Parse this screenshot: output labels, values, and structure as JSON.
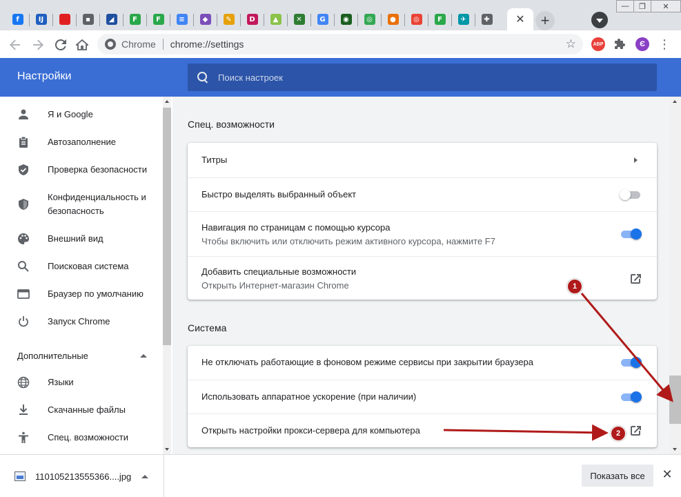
{
  "browser": {
    "tabs": [
      {
        "icon": "facebook-icon",
        "glyph": "f",
        "color": "#1877f2"
      },
      {
        "icon": "ij-icon",
        "glyph": "IJ",
        "color": "#1f5fbf"
      },
      {
        "icon": "red-flag-icon",
        "glyph": "",
        "color": "#e02020"
      },
      {
        "icon": "folder-icon",
        "glyph": "▪",
        "color": "#5f6368"
      },
      {
        "icon": "chart-icon",
        "glyph": "◢",
        "color": "#1f4f9f"
      },
      {
        "icon": "f-green-icon",
        "glyph": "F",
        "color": "#2aa84a"
      },
      {
        "icon": "f-green-icon",
        "glyph": "F",
        "color": "#2aa84a"
      },
      {
        "icon": "docs-icon",
        "glyph": "≡",
        "color": "#4285f4"
      },
      {
        "icon": "purple-diamond-icon",
        "glyph": "◆",
        "color": "#7b4fb8"
      },
      {
        "icon": "pencil-icon",
        "glyph": "✎",
        "color": "#e5a10b"
      },
      {
        "icon": "d-icon",
        "glyph": "D",
        "color": "#c2185b"
      },
      {
        "icon": "android-icon",
        "glyph": "▲",
        "color": "#8bc34a"
      },
      {
        "icon": "tools-icon",
        "glyph": "✕",
        "color": "#2e7d32"
      },
      {
        "icon": "google-icon",
        "glyph": "G",
        "color": "#4285f4"
      },
      {
        "icon": "eye-icon",
        "glyph": "◉",
        "color": "#1b5e20"
      },
      {
        "icon": "chrome-icon",
        "glyph": "◎",
        "color": "#34a853"
      },
      {
        "icon": "orange-circle-icon",
        "glyph": "●",
        "color": "#e8710a"
      },
      {
        "icon": "chrome-icon",
        "glyph": "◎",
        "color": "#ea4335"
      },
      {
        "icon": "f-green-icon",
        "glyph": "F",
        "color": "#2aa84a"
      },
      {
        "icon": "plane-icon",
        "glyph": "✈",
        "color": "#0097a7"
      },
      {
        "icon": "puzzle-icon",
        "glyph": "✚",
        "color": "#5f6368"
      }
    ],
    "active_tab_close": "✕",
    "new_tab_label": "+",
    "window_controls": [
      "—",
      "❐",
      "✕"
    ],
    "omnibox": {
      "site": "Chrome",
      "url": "chrome://settings"
    },
    "extensions": {
      "abp_label": "ABP",
      "profile_initial": "Є"
    }
  },
  "settings": {
    "header_title": "Настройки",
    "search_placeholder": "Поиск настроек",
    "sidebar": {
      "items": [
        {
          "label": "Я и Google",
          "icon": "person-icon"
        },
        {
          "label": "Автозаполнение",
          "icon": "clipboard-icon"
        },
        {
          "label": "Проверка безопасности",
          "icon": "shield-check-icon"
        },
        {
          "label": "Конфиденциальность и безопасность",
          "icon": "shield-icon"
        },
        {
          "label": "Внешний вид",
          "icon": "palette-icon"
        },
        {
          "label": "Поисковая система",
          "icon": "search-icon"
        },
        {
          "label": "Браузер по умолчанию",
          "icon": "browser-icon"
        },
        {
          "label": "Запуск Chrome",
          "icon": "power-icon"
        }
      ],
      "advanced_label": "Дополнительные",
      "advanced_items": [
        {
          "label": "Языки",
          "icon": "globe-icon"
        },
        {
          "label": "Скачанные файлы",
          "icon": "download-icon"
        },
        {
          "label": "Спец. возможности",
          "icon": "accessibility-icon"
        }
      ]
    },
    "accessibility": {
      "title": "Спец. возможности",
      "rows": [
        {
          "title": "Титры",
          "control": "chevron"
        },
        {
          "title": "Быстро выделять выбранный объект",
          "control": "toggle",
          "on": false
        },
        {
          "title": "Навигация по страницам с помощью курсора",
          "subtitle": "Чтобы включить или отключить режим активного курсора, нажмите F7",
          "control": "toggle",
          "on": true
        },
        {
          "title": "Добавить специальные возможности",
          "subtitle": "Открыть Интернет-магазин Chrome",
          "control": "external"
        }
      ]
    },
    "system": {
      "title": "Система",
      "rows": [
        {
          "title": "Не отключать работающие в фоновом режиме сервисы при закрытии браузера",
          "control": "toggle",
          "on": true
        },
        {
          "title": "Использовать аппаратное ускорение (при наличии)",
          "control": "toggle",
          "on": true
        },
        {
          "title": "Открыть настройки прокси-сервера для компьютера",
          "control": "external"
        }
      ]
    }
  },
  "downloads": {
    "file_name": "110105213555366....jpg",
    "show_all": "Показать все"
  },
  "annotations": {
    "badge1": "1",
    "badge2": "2",
    "color": "#b01a1a"
  }
}
